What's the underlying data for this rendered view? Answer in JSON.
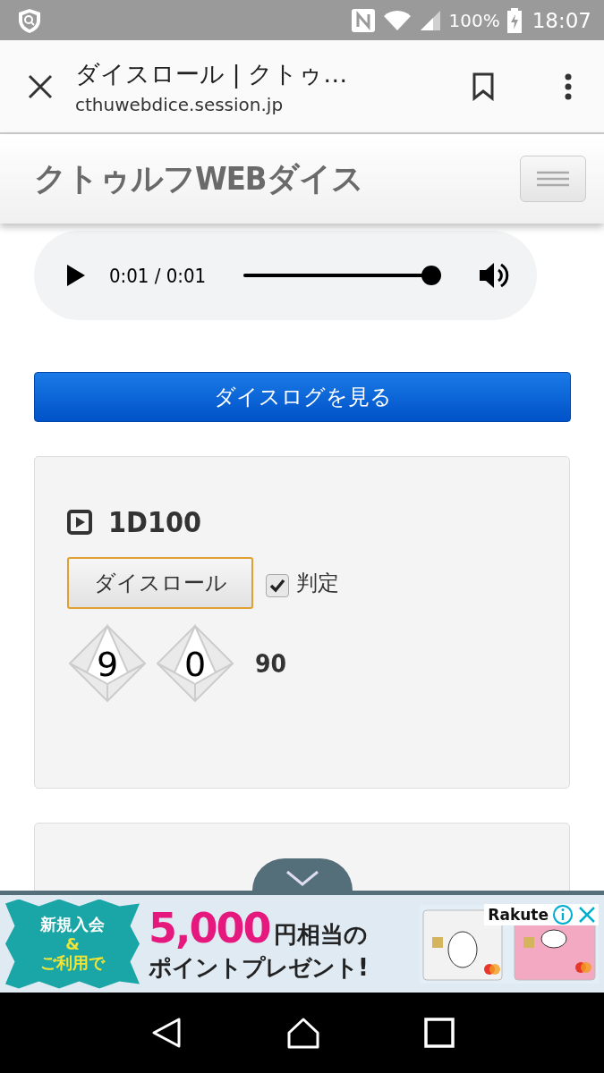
{
  "status_bar": {
    "battery": "100%",
    "time": "18:07"
  },
  "browser": {
    "title": "ダイスロール | クトゥ…",
    "url": "cthuwebdice.session.jp"
  },
  "site": {
    "title": "クトゥルフWEBダイス"
  },
  "audio": {
    "time": "0:01 / 0:01",
    "level": 1.0
  },
  "log_button": "ダイスログを見る",
  "dice_panels": [
    {
      "title": "1D100",
      "roll_button": "ダイスロール",
      "judge": {
        "label": "判定",
        "checked": true
      },
      "dice": [
        "9",
        "0"
      ],
      "total": "90"
    }
  ],
  "ad": {
    "badge": [
      "新規入会",
      "&",
      "ご利用で"
    ],
    "amount": "5,000",
    "headline_1": "円相当の",
    "headline_2": "ポイントプレゼント!",
    "brand": "Rakute"
  }
}
